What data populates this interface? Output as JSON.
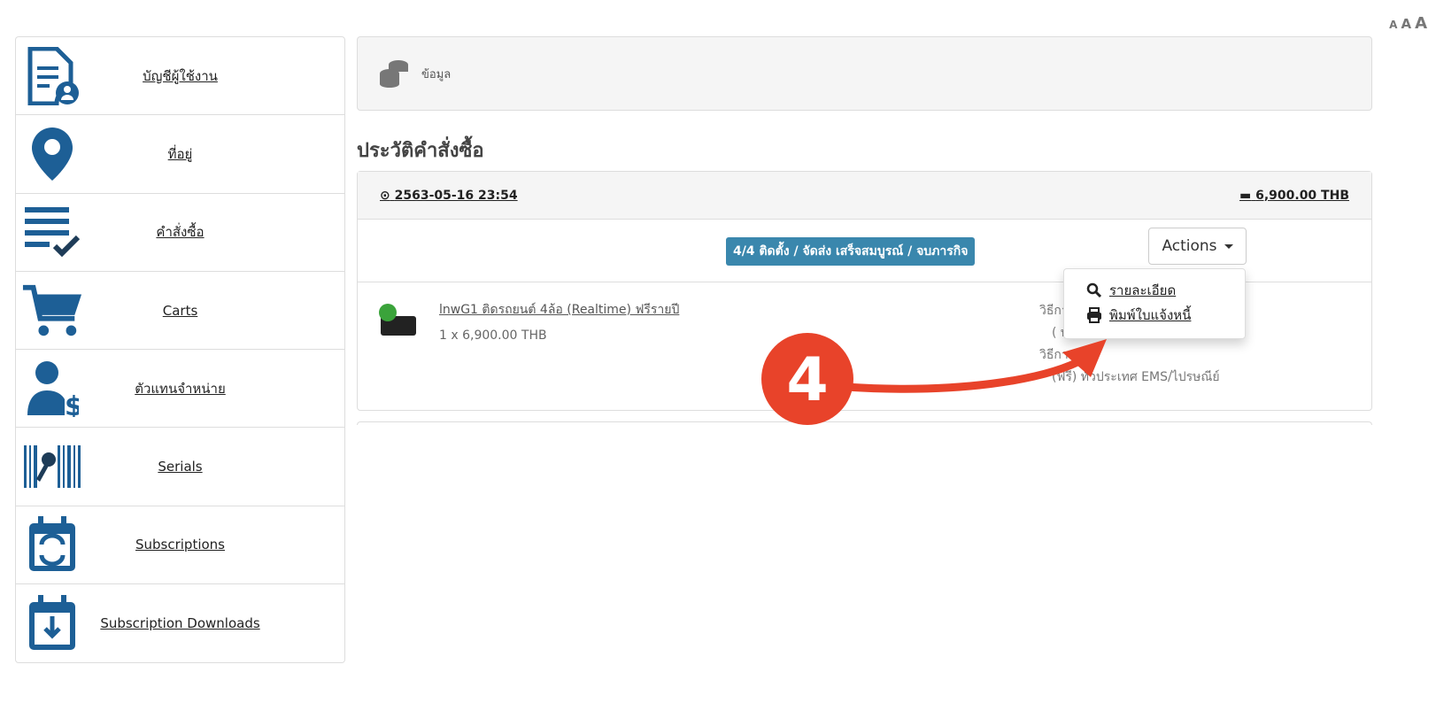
{
  "font_size_controls": [
    "A",
    "A",
    "A"
  ],
  "sidebar": {
    "items": [
      {
        "label": "บัญชีผู้ใช้งาน",
        "icon": "user-document-icon"
      },
      {
        "label": "ที่อยู่",
        "icon": "map-pin-icon"
      },
      {
        "label": "คำสั่งซื้อ",
        "icon": "list-check-icon"
      },
      {
        "label": "Carts",
        "icon": "cart-icon"
      },
      {
        "label": "ตัวแทนจำหน่าย",
        "icon": "user-dollar-icon"
      },
      {
        "label": "Serials",
        "icon": "barcode-key-icon"
      },
      {
        "label": "Subscriptions",
        "icon": "calendar-refresh-icon"
      },
      {
        "label": "Subscription Downloads",
        "icon": "calendar-download-icon"
      }
    ]
  },
  "info_panel": {
    "label": "ข้อมูล",
    "icon": "coins-icon"
  },
  "page_title": "ประวัติคำสั่งซื้อ",
  "order": {
    "date": "2563-05-16 23:54",
    "total": "6,900.00 THB",
    "status": "4/4 ติดตั้ง / จัดส่ง เสร็จสมบูรณ์ / จบภารกิจ",
    "actions_label": "Actions",
    "menu": [
      {
        "label": "รายละเอียด",
        "icon": "search-icon"
      },
      {
        "label": "พิมพ์ใบแจ้งหนี้",
        "icon": "print-icon"
      }
    ],
    "product_name": "lnwG1 ติดรถยนต์ 4ล้อ (Realtime) ฟรีรายปี",
    "product_qty": "1 x 6,900.00 THB",
    "ship_lines": [
      "วิธีกา",
      "( บ",
      "วิธีกา",
      "(ฟรี) ทั่วประเทศ EMS/ไปรษณีย์"
    ]
  },
  "annotation": {
    "step": "4",
    "color": "#e8432a"
  },
  "colors": {
    "icon": "#1d5f96",
    "badge": "#3a87ad"
  }
}
